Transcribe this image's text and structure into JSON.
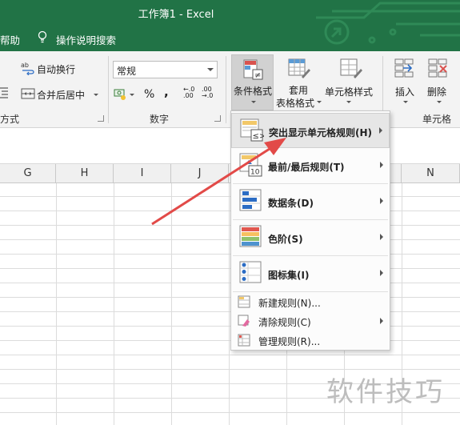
{
  "window": {
    "title": "工作簿1  -  Excel"
  },
  "tell_bar": {
    "help": "帮助",
    "tell_me": "操作说明搜索"
  },
  "ribbon": {
    "alignment": {
      "wrap_text": "自动换行",
      "merge_center": "合并后居中",
      "group_label": "方式"
    },
    "number": {
      "format_value": "常规",
      "percent": "%",
      "comma": ",",
      "inc_decimal": "←.0 .00",
      "dec_decimal": ".00 →.0",
      "group_label": "数字"
    },
    "styles": {
      "conditional_format": "条件格式",
      "format_as_table_1": "套用",
      "format_as_table_2": "表格格式",
      "cell_styles": "单元格样式"
    },
    "cells": {
      "insert": "插入",
      "delete": "删除",
      "group_label": "单元格"
    }
  },
  "columns": [
    "G",
    "H",
    "I",
    "J",
    "N"
  ],
  "menu": {
    "items": [
      {
        "label": "突出显示单元格规则(H)",
        "submenu": true
      },
      {
        "label": "最前/最后规则(T)",
        "submenu": true
      },
      {
        "label": "数据条(D)",
        "submenu": true
      },
      {
        "label": "色阶(S)",
        "submenu": true
      },
      {
        "label": "图标集(I)",
        "submenu": true
      },
      {
        "label": "新建规则(N)...",
        "submenu": false
      },
      {
        "label": "清除规则(C)",
        "submenu": true
      },
      {
        "label": "管理规则(R)...",
        "submenu": false
      }
    ]
  },
  "watermark": "软件技巧",
  "colors": {
    "excel_green": "#217346",
    "arrow": "#e24a48"
  }
}
